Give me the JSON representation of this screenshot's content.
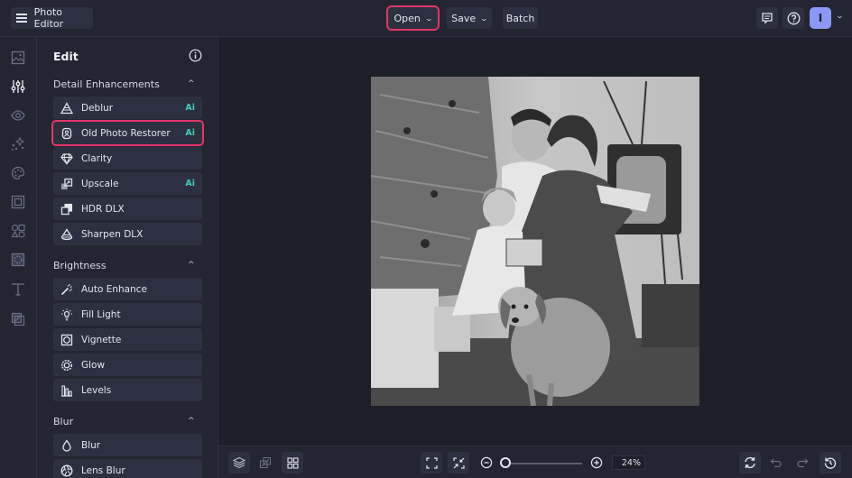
{
  "topbar": {
    "app_title": "Photo Editor",
    "open_label": "Open",
    "save_label": "Save",
    "batch_label": "Batch",
    "avatar_initial": "I"
  },
  "rail": {
    "items": [
      {
        "name": "image",
        "active": false
      },
      {
        "name": "edit-adjust",
        "active": true
      },
      {
        "name": "eye",
        "active": false
      },
      {
        "name": "effects",
        "active": false
      },
      {
        "name": "palette",
        "active": false
      },
      {
        "name": "frames",
        "active": false
      },
      {
        "name": "shapes",
        "active": false
      },
      {
        "name": "textures",
        "active": false
      },
      {
        "name": "text",
        "active": false
      },
      {
        "name": "overlay",
        "active": false
      }
    ]
  },
  "panel": {
    "title": "Edit",
    "sections": [
      {
        "title": "Detail Enhancements",
        "items": [
          {
            "label": "Deblur",
            "ai": "Ai",
            "icon": "deblur-icon"
          },
          {
            "label": "Old Photo Restorer",
            "ai": "Ai",
            "icon": "restorer-icon",
            "highlighted": true
          },
          {
            "label": "Clarity",
            "ai": "",
            "icon": "diamond-icon"
          },
          {
            "label": "Upscale",
            "ai": "Ai",
            "icon": "upscale-icon"
          },
          {
            "label": "HDR DLX",
            "ai": "",
            "icon": "hdr-icon"
          },
          {
            "label": "Sharpen DLX",
            "ai": "",
            "icon": "sharpen-icon"
          }
        ]
      },
      {
        "title": "Brightness",
        "items": [
          {
            "label": "Auto Enhance",
            "icon": "magic-wand-icon"
          },
          {
            "label": "Fill Light",
            "icon": "lightbulb-icon"
          },
          {
            "label": "Vignette",
            "icon": "vignette-icon"
          },
          {
            "label": "Glow",
            "icon": "glow-icon"
          },
          {
            "label": "Levels",
            "icon": "levels-icon"
          }
        ]
      },
      {
        "title": "Blur",
        "items": [
          {
            "label": "Blur",
            "icon": "droplet-icon"
          },
          {
            "label": "Lens Blur",
            "icon": "aperture-icon"
          }
        ]
      }
    ]
  },
  "canvas": {
    "photo_description": "Black and white vintage family photo by Christmas tree with dog"
  },
  "bottombar": {
    "zoom_percent": 24,
    "zoom_label": "24%",
    "zoom_slider_fraction": 0.0
  },
  "colors": {
    "highlight": "#e3356a",
    "ai_badge": "#3fcfb4",
    "avatar": "#8c98f7"
  }
}
